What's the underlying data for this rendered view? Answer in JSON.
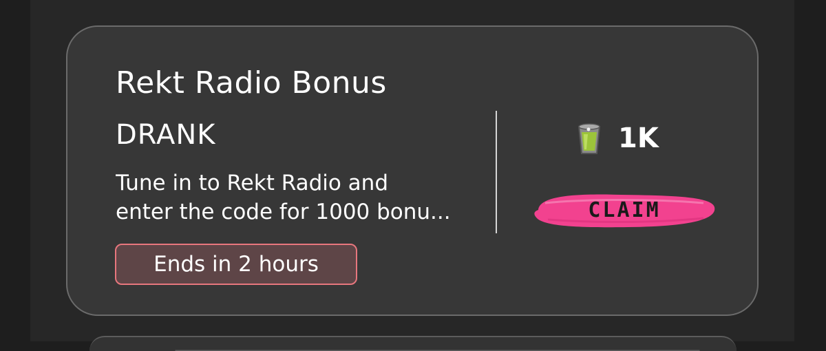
{
  "card": {
    "title": "Rekt Radio Bonus",
    "subtitle": "DRANK",
    "description_lines": [
      "Tune in to Rekt Radio and",
      "enter the code for 1000 bonu..."
    ],
    "badge": "Ends in 2 hours",
    "reward": {
      "icon": "drank-cup-icon",
      "amount": "1K"
    },
    "claim_label": "CLAIM"
  },
  "colors": {
    "background": "#1e1e1e",
    "panel": "#272727",
    "card": "#373737",
    "card_border": "#6b6b6b",
    "badge_border": "#e8777e",
    "badge_fill": "#5e4547",
    "claim_pink": "#f2428f",
    "cup_green": "#9cc43a"
  }
}
